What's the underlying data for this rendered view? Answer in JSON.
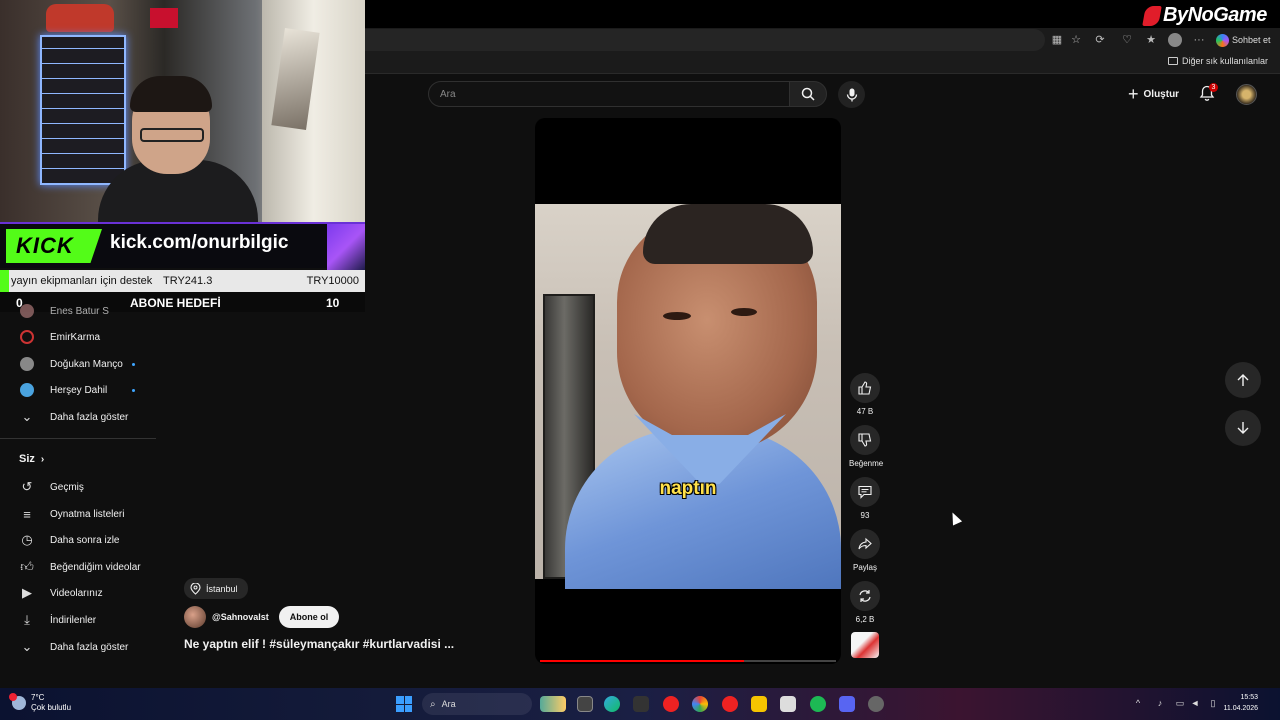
{
  "brand": {
    "name": "ByNoGame"
  },
  "browser": {
    "copilot_label": "Sohbet et",
    "bookmarks_other": "Diğer sık kullanılanlar"
  },
  "stream_overlay": {
    "kick_logo": "KICK",
    "kick_url": "kick.com/onurbilgic",
    "donation_label": "yayın ekipmanları için destek",
    "donation_current": "TRY241.3",
    "donation_goal": "TRY10000",
    "donation_progress": 0.024,
    "sub_goal_current": "0",
    "sub_goal_title": "ABONE HEDEFİ",
    "sub_goal_target": "10",
    "accent_color": "#53fc18"
  },
  "sidebar": {
    "subscriptions": [
      {
        "label": "Enes Batur S",
        "live": false
      },
      {
        "label": "EmirKarma",
        "live": false
      },
      {
        "label": "Doğukan Manço",
        "live": true
      },
      {
        "label": "Herşey Dahil",
        "live": true
      }
    ],
    "show_more_1": "Daha fazla göster",
    "section_you": "Siz",
    "you_items": [
      {
        "label": "Geçmiş",
        "icon": "history-icon"
      },
      {
        "label": "Oynatma listeleri",
        "icon": "playlist-icon"
      },
      {
        "label": "Daha sonra izle",
        "icon": "clock-icon"
      },
      {
        "label": "Beğendiğim videolar",
        "icon": "thumbs-up-icon"
      },
      {
        "label": "Videolarınız",
        "icon": "video-icon"
      },
      {
        "label": "İndirilenler",
        "icon": "download-icon"
      }
    ],
    "show_more_2": "Daha fazla göster"
  },
  "header": {
    "search_placeholder": "Ara",
    "create_label": "Oluştur",
    "notification_count": "3"
  },
  "short": {
    "caption": "naptın",
    "progress": 0.69,
    "likes": "47 B",
    "dislike_label": "Beğenme",
    "comments": "93",
    "share_label": "Paylaş",
    "remix_count": "6,2 B",
    "location": "İstanbul",
    "channel": "@Sahnovalst",
    "subscribe_label": "Abone ol",
    "title": "Ne yaptın elif ! #süleymançakır #kurtlarvadisi ..."
  },
  "taskbar": {
    "temperature": "7°C",
    "weather": "Çok bulutlu",
    "search_label": "Ara",
    "time": "15:53",
    "date": "11.04.2026"
  }
}
